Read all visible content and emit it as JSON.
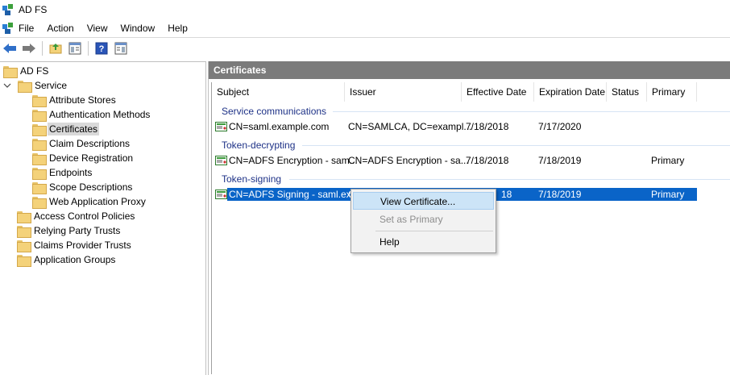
{
  "window": {
    "title": "AD FS"
  },
  "menu": [
    "File",
    "Action",
    "View",
    "Window",
    "Help"
  ],
  "toolbar": {
    "icons": [
      "back-icon",
      "forward-icon",
      "up-folder-icon",
      "show-hide-tree-icon",
      "help-icon",
      "properties-icon"
    ]
  },
  "tree": {
    "root": "AD FS",
    "service": "Service",
    "service_children": [
      "Attribute Stores",
      "Authentication Methods",
      "Certificates",
      "Claim Descriptions",
      "Device Registration",
      "Endpoints",
      "Scope Descriptions",
      "Web Application Proxy"
    ],
    "others": [
      "Access Control Policies",
      "Relying Party Trusts",
      "Claims Provider Trusts",
      "Application Groups"
    ],
    "selected": "Certificates"
  },
  "pane": {
    "title": "Certificates"
  },
  "columns": [
    "Subject",
    "Issuer",
    "Effective Date",
    "Expiration Date",
    "Status",
    "Primary"
  ],
  "groups": [
    {
      "label": "Service communications",
      "rows": [
        {
          "subject": "CN=saml.example.com",
          "issuer": "CN=SAMLCA, DC=exampl...",
          "effective": "7/18/2018",
          "expiration": "7/17/2020",
          "status": "",
          "primary": ""
        }
      ]
    },
    {
      "label": "Token-decrypting",
      "rows": [
        {
          "subject": "CN=ADFS Encryption - sam...",
          "issuer": "CN=ADFS Encryption - sa...",
          "effective": "7/18/2018",
          "expiration": "7/18/2019",
          "status": "",
          "primary": "Primary"
        }
      ]
    },
    {
      "label": "Token-signing",
      "rows": [
        {
          "subject": "CN=ADFS Signing - saml.ex...",
          "issuer": "C",
          "effective": "18",
          "expiration": "7/18/2019",
          "status": "",
          "primary": "Primary"
        }
      ]
    }
  ],
  "context_menu": {
    "items": [
      "View Certificate...",
      "Set as Primary",
      "Help"
    ],
    "hovered": "View Certificate...",
    "disabled": "Set as Primary"
  },
  "colors": {
    "selection": "#0a64c8",
    "group_text": "#1e3287",
    "header_bar": "#7b7b7b",
    "menu_hover": "#cce4f7"
  }
}
